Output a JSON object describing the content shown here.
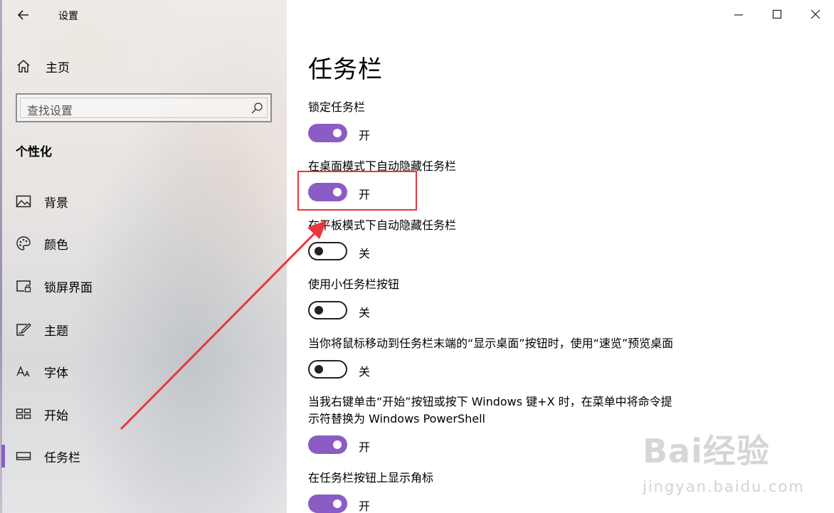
{
  "window": {
    "title": "设置"
  },
  "sidebar": {
    "home_label": "主页",
    "search_placeholder": "查找设置",
    "section_title": "个性化",
    "items": [
      {
        "label": "背景",
        "icon": "image-icon"
      },
      {
        "label": "颜色",
        "icon": "palette-icon"
      },
      {
        "label": "锁屏界面",
        "icon": "lock-screen-icon"
      },
      {
        "label": "主题",
        "icon": "theme-icon"
      },
      {
        "label": "字体",
        "icon": "font-icon"
      },
      {
        "label": "开始",
        "icon": "start-icon"
      },
      {
        "label": "任务栏",
        "icon": "taskbar-icon",
        "active": true
      }
    ]
  },
  "main": {
    "page_title": "任务栏",
    "settings": [
      {
        "label": "锁定任务栏",
        "state": "开",
        "on": true
      },
      {
        "label": "在桌面模式下自动隐藏任务栏",
        "state": "开",
        "on": true
      },
      {
        "label": "在平板模式下自动隐藏任务栏",
        "state": "关",
        "on": false
      },
      {
        "label": "使用小任务栏按钮",
        "state": "关",
        "on": false
      },
      {
        "label": "当你将鼠标移动到任务栏末端的“显示桌面”按钮时，使用“速览”预览桌面",
        "state": "关",
        "on": false
      },
      {
        "label_line1": "当我右键单击“开始”按钮或按下 Windows 键+X 时，在菜单中将命令提",
        "label_line2": "示符替换为 Windows PowerShell",
        "state": "开",
        "on": true
      },
      {
        "label": "在任务栏按钮上显示角标",
        "state": "开",
        "on": true
      }
    ]
  },
  "watermark": {
    "brand": "Bai经验",
    "url": "jingyan.baidu.com"
  },
  "colors": {
    "accent": "#8a5cc4",
    "highlight": "#e7373c"
  }
}
